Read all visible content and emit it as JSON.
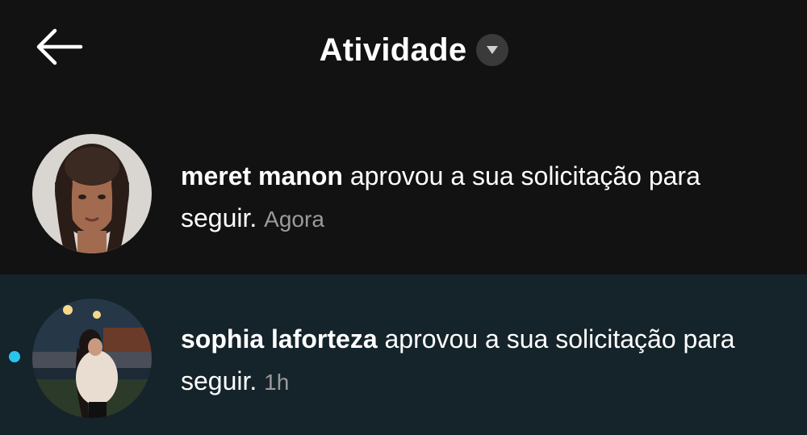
{
  "header": {
    "title": "Atividade",
    "back_icon": "arrow-left-icon",
    "dropdown_icon": "caret-down-icon"
  },
  "notifications": [
    {
      "username": "meret manon",
      "message": "aprovou a sua solicitação para seguir.",
      "time": "Agora",
      "unread": false
    },
    {
      "username": "sophia laforteza",
      "message": "aprovou a sua solicitação para seguir.",
      "time": "1h",
      "unread": true
    }
  ],
  "colors": {
    "background": "#121212",
    "unread_background": "#15232a",
    "unread_dot": "#2bc4ee",
    "timestamp": "#9a9a9a"
  }
}
